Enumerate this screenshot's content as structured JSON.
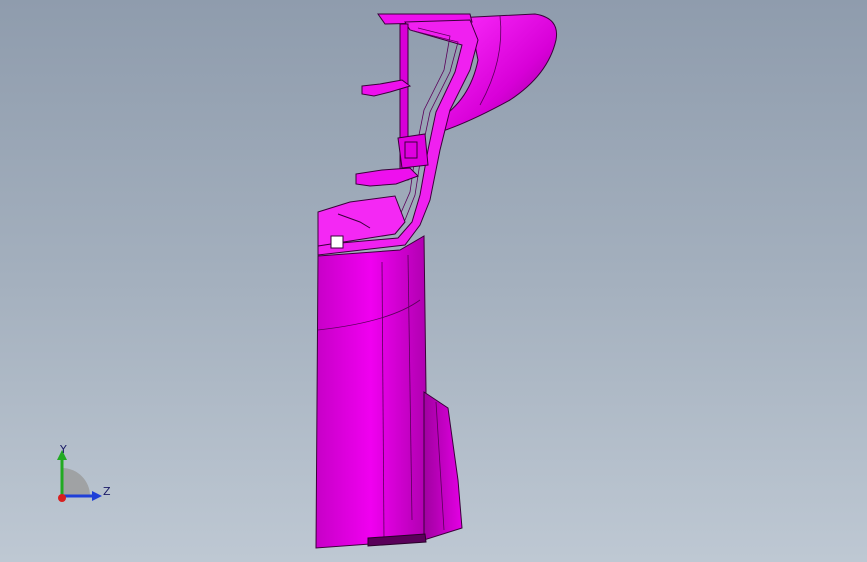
{
  "viewport": {
    "background_top": "#8f9cad",
    "background_bottom": "#bec8d3"
  },
  "model": {
    "part_color": "#e000e0",
    "edge_color": "#3a003a"
  },
  "triad": {
    "y_label": "Y",
    "z_label": "Z",
    "y_color": "#22aa22",
    "z_color": "#1f3fd8",
    "x_color": "#d81f1f"
  }
}
